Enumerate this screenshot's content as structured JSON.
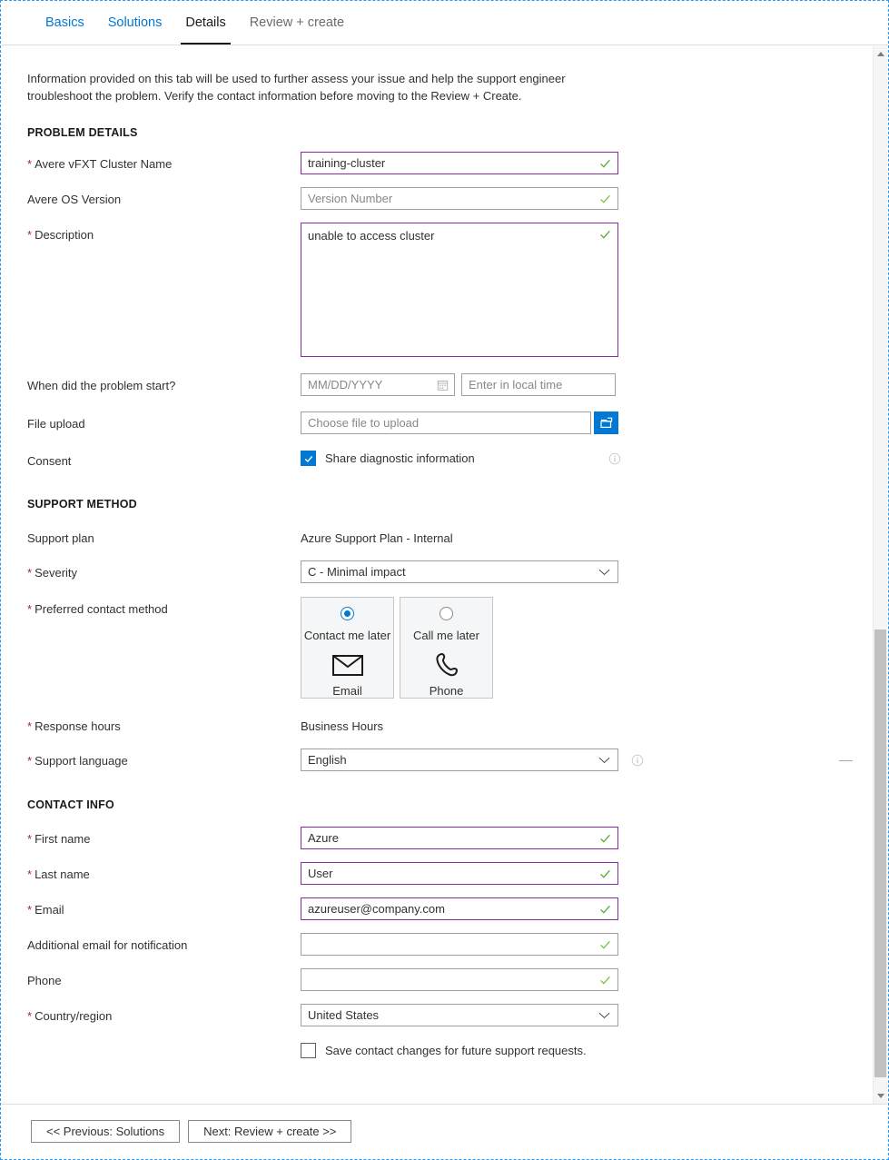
{
  "tabs": [
    {
      "label": "Basics",
      "state": "link"
    },
    {
      "label": "Solutions",
      "state": "link"
    },
    {
      "label": "Details",
      "state": "active"
    },
    {
      "label": "Review + create",
      "state": "muted"
    }
  ],
  "intro": "Information provided on this tab will be used to further assess your issue and help the support engineer troubleshoot the problem. Verify the contact information before moving to the Review + Create.",
  "sections": {
    "problem_details": {
      "heading": "PROBLEM DETAILS",
      "cluster_name": {
        "label": "Avere vFXT Cluster Name",
        "value": "training-cluster",
        "required": true
      },
      "os_version": {
        "label": "Avere OS Version",
        "placeholder": "Version Number",
        "value": "",
        "required": false
      },
      "description": {
        "label": "Description",
        "value": "unable to access cluster",
        "required": true
      },
      "problem_start": {
        "label": "When did the problem start?",
        "date_placeholder": "MM/DD/YYYY",
        "date_value": "",
        "time_placeholder": "Enter in local time",
        "time_value": ""
      },
      "file_upload": {
        "label": "File upload",
        "placeholder": "Choose file to upload",
        "value": "",
        "button_icon": "upload-folder-icon"
      },
      "consent": {
        "label": "Consent",
        "checkbox_label": "Share diagnostic information",
        "checked": true,
        "info_icon": "info-icon"
      }
    },
    "support_method": {
      "heading": "SUPPORT METHOD",
      "support_plan": {
        "label": "Support plan",
        "value": "Azure Support Plan - Internal"
      },
      "severity": {
        "label": "Severity",
        "value": "C - Minimal impact",
        "required": true
      },
      "preferred_contact_method": {
        "label": "Preferred contact method",
        "required": true,
        "options": [
          {
            "title": "Contact me later",
            "sub": "Email",
            "icon": "envelope-icon",
            "selected": true
          },
          {
            "title": "Call me later",
            "sub": "Phone",
            "icon": "phone-icon",
            "selected": false
          }
        ]
      },
      "response_hours": {
        "label": "Response hours",
        "value": "Business Hours",
        "required": true
      },
      "support_language": {
        "label": "Support language",
        "value": "English",
        "required": true,
        "info_icon": "info-icon"
      }
    },
    "contact_info": {
      "heading": "CONTACT INFO",
      "first_name": {
        "label": "First name",
        "value": "Azure",
        "required": true
      },
      "last_name": {
        "label": "Last name",
        "value": "User",
        "required": true
      },
      "email": {
        "label": "Email",
        "value": "azureuser@company.com",
        "required": true
      },
      "additional_email": {
        "label": "Additional email for notification",
        "value": "",
        "required": false
      },
      "phone": {
        "label": "Phone",
        "value": "",
        "required": false
      },
      "country_region": {
        "label": "Country/region",
        "value": "United States",
        "required": true
      },
      "save_contact": {
        "checkbox_label": "Save contact changes for future support requests.",
        "checked": false
      }
    }
  },
  "footer": {
    "previous_label": "<< Previous: Solutions",
    "next_label": "Next: Review + create >>"
  },
  "colors": {
    "accent": "#0078d4",
    "filled_border": "#8b29a5",
    "valid_check": "#5ba832",
    "required_star": "#a4262c",
    "frame_dash": "#2899f5"
  }
}
